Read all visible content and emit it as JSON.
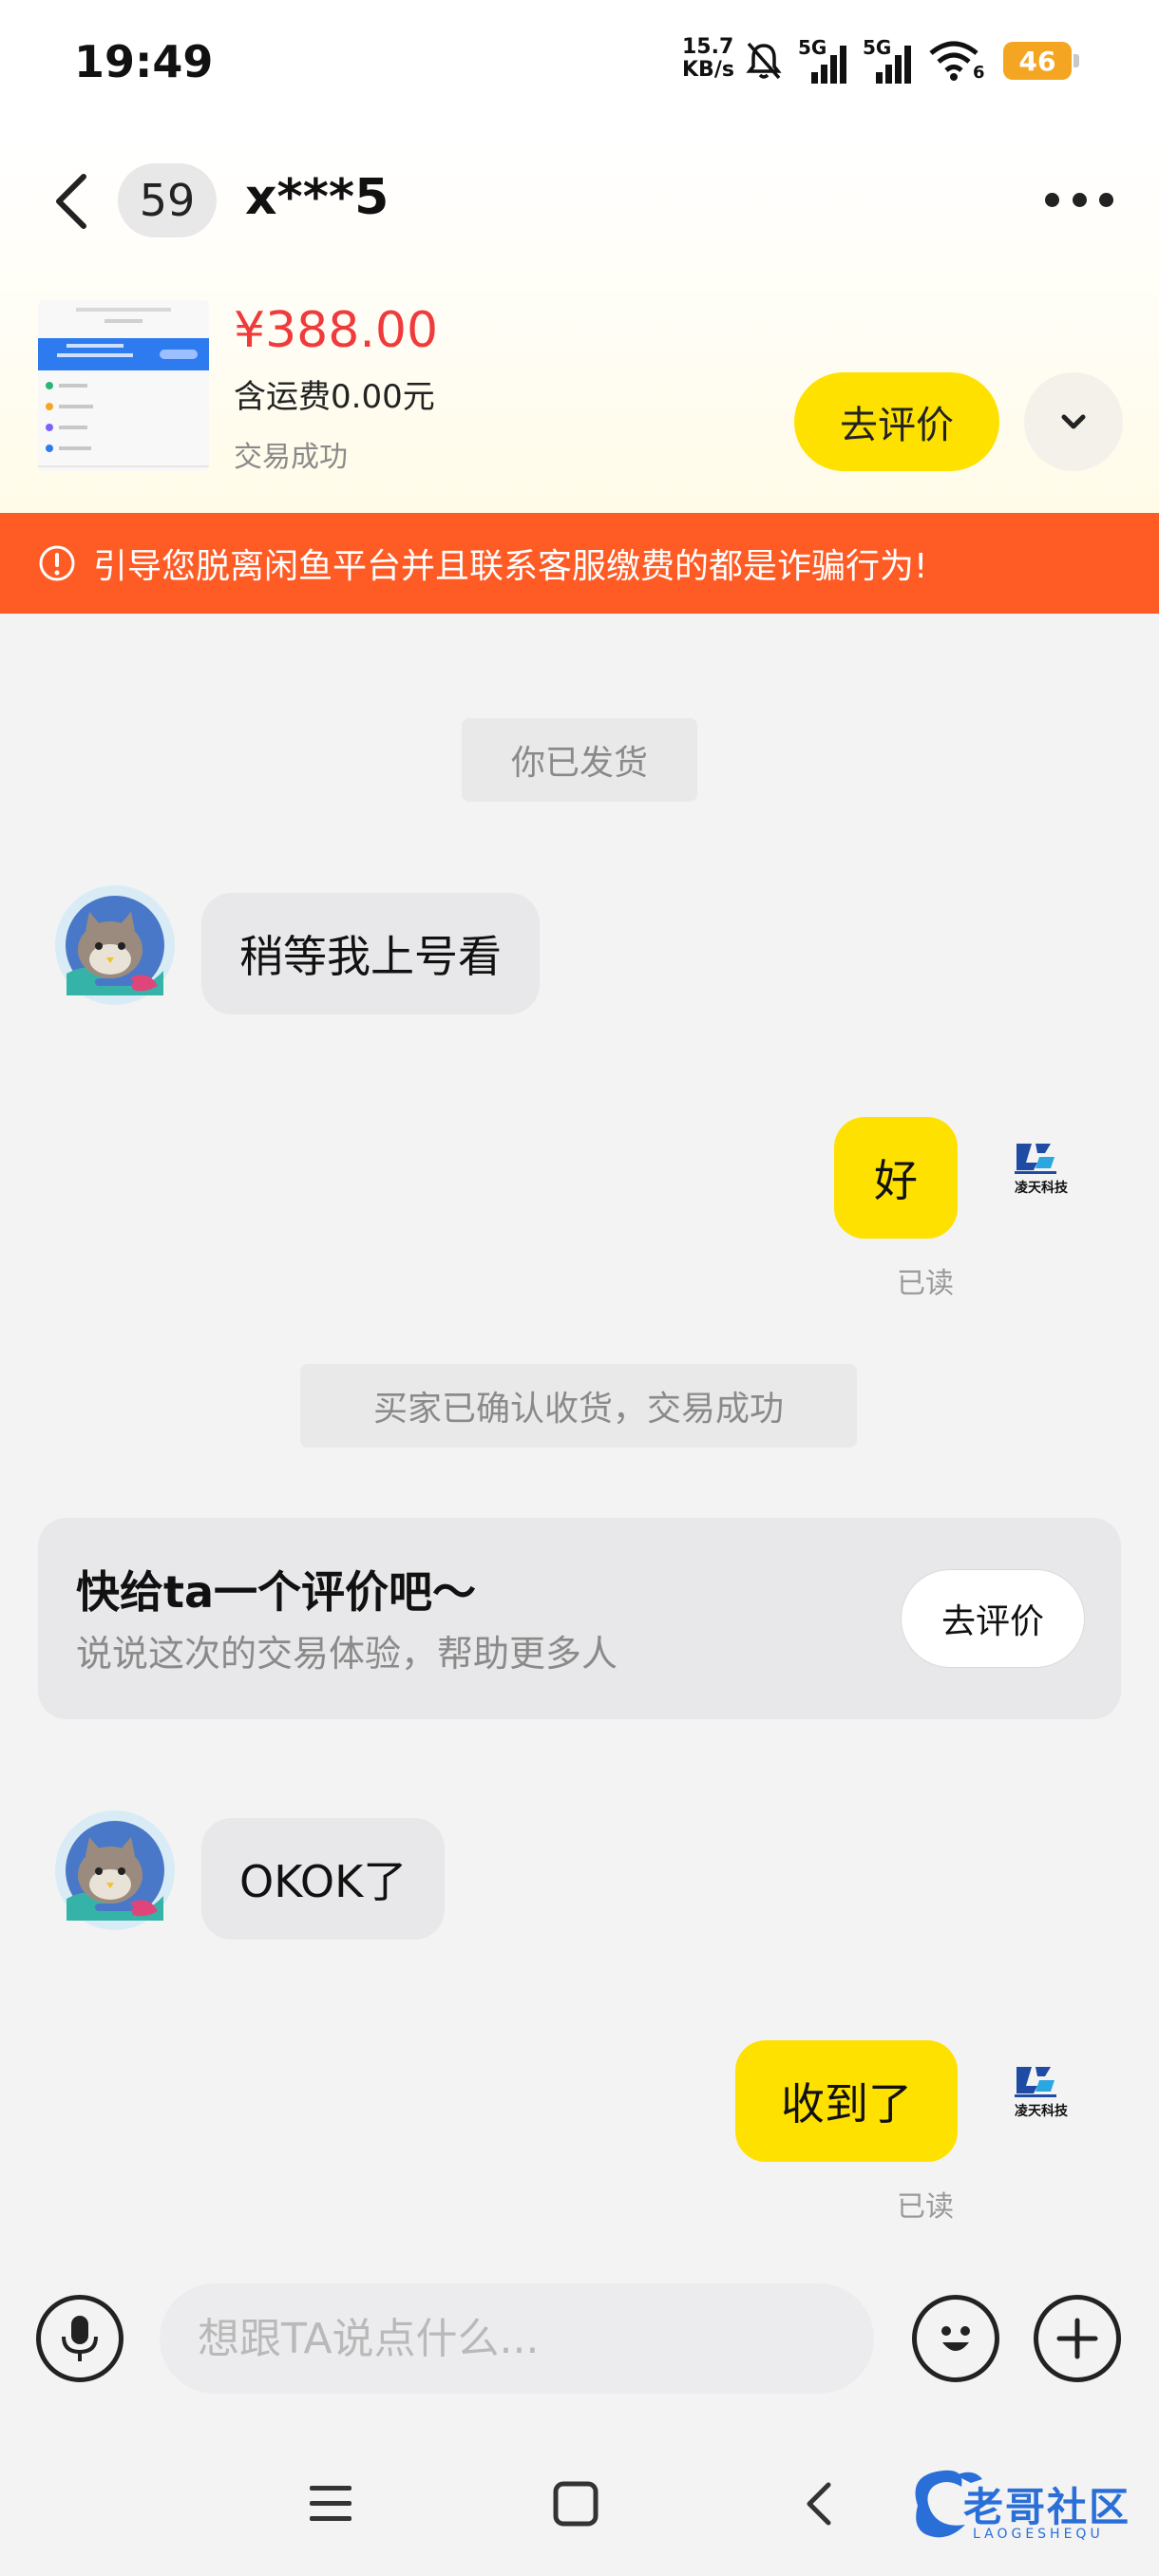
{
  "status_bar": {
    "time": "19:49",
    "net_speed_value": "15.7",
    "net_speed_unit": "KB/s",
    "signal_label_1": "5G",
    "signal_label_2": "5G",
    "wifi_label": "6",
    "battery": "46",
    "icons": [
      "bell-off-icon",
      "signal-icon",
      "signal-icon",
      "wifi-icon",
      "battery-icon"
    ]
  },
  "header": {
    "unread_count": "59",
    "peer_name": "x***5"
  },
  "product": {
    "price": "¥388.00",
    "shipping": "含运费0.00元",
    "status": "交易成功",
    "review_button": "去评价"
  },
  "warning": {
    "text": "引导您脱离闲鱼平台并且联系客服缴费的都是诈骗行为!"
  },
  "chat": {
    "tip_shipped": "你已发货",
    "msg_peer_1": "稍等我上号看",
    "msg_me_1": "好",
    "read_1": "已读",
    "tip_confirmed": "买家已确认收货，交易成功",
    "review_card": {
      "title": "快给ta一个评价吧～",
      "subtitle": "说说这次的交易体验，帮助更多人",
      "button": "去评价"
    },
    "msg_peer_2": "OKOK了",
    "msg_me_2": "收到了",
    "read_2": "已读",
    "my_avatar_text": "凌天科技"
  },
  "input": {
    "placeholder": "想跟TA说点什么..."
  },
  "watermark": {
    "text": "老哥社区",
    "sub": "LAOGESHEQU"
  },
  "colors": {
    "accent_yellow": "#ffe100",
    "warning_orange": "#ff5b25",
    "price_red": "#ef3b3b"
  }
}
